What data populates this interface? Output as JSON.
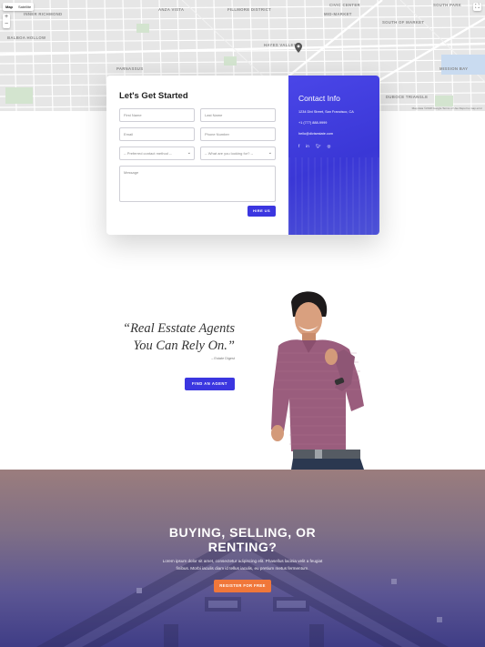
{
  "map": {
    "tabs": [
      "Map",
      "Satellite"
    ],
    "active_tab": "Map",
    "zoom_in": "+",
    "zoom_out": "−",
    "fullscreen": "⛶",
    "labels": [
      {
        "text": "INNER RICHMOND",
        "id": "inner-richmond"
      },
      {
        "text": "BALBOA HOLLOW",
        "id": "balboa-hollow"
      },
      {
        "text": "ANZA VISTA",
        "id": "anza-vista"
      },
      {
        "text": "FILLMORE DISTRICT",
        "id": "fillmore-district"
      },
      {
        "text": "CIVIC CENTER",
        "id": "civic-center"
      },
      {
        "text": "MID-MARKET",
        "id": "mid-market"
      },
      {
        "text": "SOUTH PARK",
        "id": "south-park"
      },
      {
        "text": "SOUTH OF MARKET",
        "id": "south-of-market"
      },
      {
        "text": "HAYES VALLEY",
        "id": "hayes-valley"
      },
      {
        "text": "PARNASSUS",
        "id": "parnassus"
      },
      {
        "text": "MISSION BAY",
        "id": "mission-bay"
      },
      {
        "text": "DUBOCE TRIANGLE",
        "id": "duboce-triangle"
      }
    ],
    "footer": "Map data ©2018 Google   Terms of Use   Report a map error"
  },
  "contact_form": {
    "title": "Let's Get Started",
    "first_name_placeholder": "First Name",
    "last_name_placeholder": "Last Name",
    "email_placeholder": "Email",
    "phone_placeholder": "Phone Number",
    "contact_method_select": "-- Preferred contact method --",
    "looking_for_select": "-- What are you looking for? --",
    "message_placeholder": "Message",
    "submit_label": "HIRE US"
  },
  "contact_info": {
    "title": "Contact Info",
    "address": "1234 Divi Street, San Francisco, CA",
    "phone": "+1 (777) 888-9999",
    "email": "hello@divisestate.com",
    "social_icons": [
      "facebook-icon",
      "linkedin-icon",
      "twitter-icon",
      "instagram-icon"
    ]
  },
  "quote": {
    "line1": "“Real Esstate Agents",
    "line2": "You Can Rely On.”",
    "source": "– Estate Digest",
    "button_label": "FIND AN AGENT"
  },
  "hero": {
    "title_line1": "BUYING, SELLING, OR",
    "title_line2": "RENTING?",
    "text_line1": "Lorem ipsum dolor sit amet, consectetur adipiscing elit. Phasellus lacinia velit a feugiat",
    "text_line2": "finibus. Morbi iaculis diam id tellus iaculis, eu pretium metus fermentum.",
    "button_label": "REGISTER FOR FREE"
  },
  "colors": {
    "accent": "#3b36e0",
    "cta_orange": "#f0773a"
  }
}
